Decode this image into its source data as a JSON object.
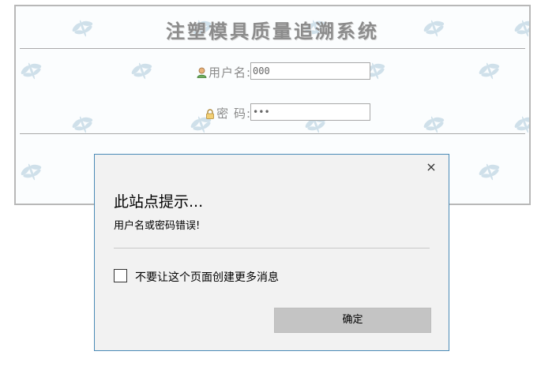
{
  "login": {
    "system_title": "注塑模具质量追溯系统",
    "username_label": "用户名:",
    "username_value": "000",
    "password_label": "密 码:",
    "password_value": "•••"
  },
  "dialog": {
    "title": "此站点提示...",
    "message": "用户名或密码错误!",
    "checkbox_label": "不要让这个页面创建更多消息",
    "ok_label": "确定",
    "close_glyph": "×"
  },
  "icons": {
    "user": "user-icon",
    "lock": "lock-icon",
    "dragonfly": "dragonfly-icon"
  },
  "colors": {
    "title": "#8c8c8c",
    "panel_border": "#b8b8b8",
    "dialog_border": "#4a8ab6",
    "dialog_bg": "#f2f2f2",
    "ok_button": "#c4c4c4",
    "pattern": "#c9dbe6"
  }
}
